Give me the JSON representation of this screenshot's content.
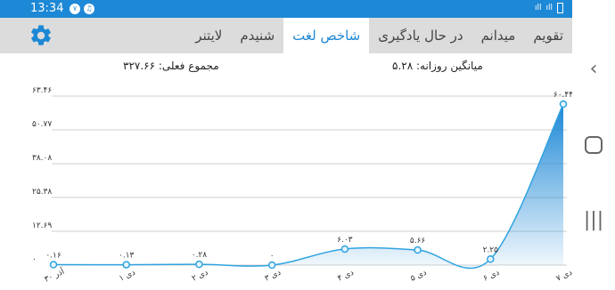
{
  "status_bar": {
    "time": "13:34",
    "notif_badge": "٧"
  },
  "tabs": [
    {
      "label": "تقویم",
      "active": false
    },
    {
      "label": "میدانم",
      "active": false
    },
    {
      "label": "در حال یادگیری",
      "active": false
    },
    {
      "label": "شاخص لغت",
      "active": true
    },
    {
      "label": "شنیدم",
      "active": false
    },
    {
      "label": "لایتنر",
      "active": false
    }
  ],
  "stats": {
    "total_label": "مجموع فعلی: ۳۲۷.۶۶",
    "daily_avg_label": "میانگین روزانه: ۵.۲۸"
  },
  "colors": {
    "accent": "#1d88d6",
    "line": "#2ea3e0",
    "tab_bg": "#dcdcdc"
  },
  "chart_data": {
    "type": "area",
    "categories": [
      "۳۰ آذر",
      "۱ دی",
      "۲ دی",
      "۳ دی",
      "۴ دی",
      "۵ دی",
      "۶ دی",
      "۷ دی"
    ],
    "values": [
      0.16,
      0.13,
      0.28,
      0,
      6.03,
      5.66,
      2.25,
      60.44
    ],
    "data_labels": [
      "۰.۱۶",
      "۰.۱۳",
      "۰.۲۸",
      "۰",
      "۶.۰۳",
      "۵.۶۶",
      "۲.۲۵",
      "۶۰.۴۴"
    ],
    "y_ticks": [
      "۰",
      "۱۲.۶۹",
      "۲۵.۳۸",
      "۳۸.۰۸",
      "۵۰.۷۷",
      "۶۳.۴۶"
    ],
    "ylim": [
      0,
      63.46
    ],
    "grid": true
  }
}
